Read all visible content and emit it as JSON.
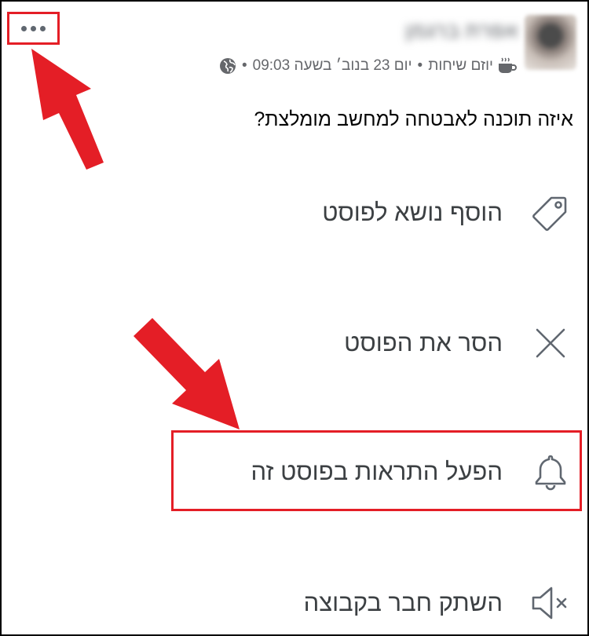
{
  "post": {
    "author_name": "אפרת ברגמן",
    "meta": {
      "group_badge": "יוזם שיחות",
      "separator": "•",
      "timestamp": "יום 23 בנוב׳ בשעה 09:03"
    },
    "text": "איזה תוכנה לאבטחה למחשב מומלצת?"
  },
  "menu": {
    "items": [
      {
        "icon": "tag-icon",
        "label": "הוסף נושא לפוסט"
      },
      {
        "icon": "close-icon",
        "label": "הסר את הפוסט"
      },
      {
        "icon": "bell-icon",
        "label": "הפעל התראות בפוסט זה"
      },
      {
        "icon": "mute-icon",
        "label": "השתק חבר בקבוצה"
      }
    ]
  },
  "colors": {
    "annotation_red": "#e41e26",
    "icon_gray": "#606770",
    "meta_gray": "#65676b"
  }
}
